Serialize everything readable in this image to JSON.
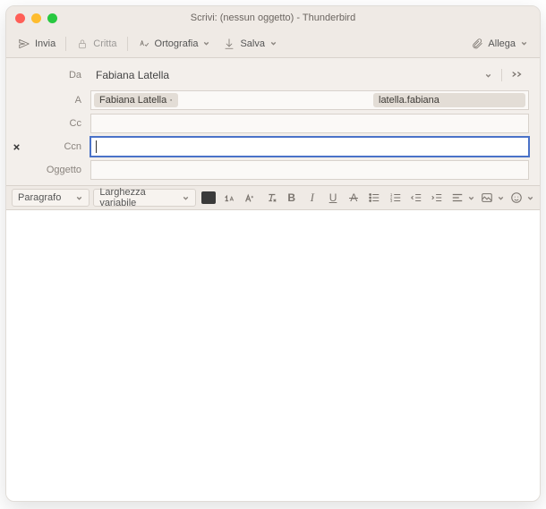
{
  "window": {
    "title": "Scrivi: (nessun oggetto) - Thunderbird"
  },
  "toolbar": {
    "send": "Invia",
    "encrypt": "Critta",
    "spelling": "Ortografia",
    "save": "Salva",
    "attach": "Allega"
  },
  "headers": {
    "from_label": "Da",
    "from_value": "Fabiana Latella",
    "to_label": "A",
    "to_pills": [
      "Fabiana Latella ·",
      "latella.fabiana"
    ],
    "cc_label": "Cc",
    "bcc_label": "Ccn",
    "subject_label": "Oggetto"
  },
  "format": {
    "paragraph": "Paragrafo",
    "font": "Larghezza variabile"
  }
}
